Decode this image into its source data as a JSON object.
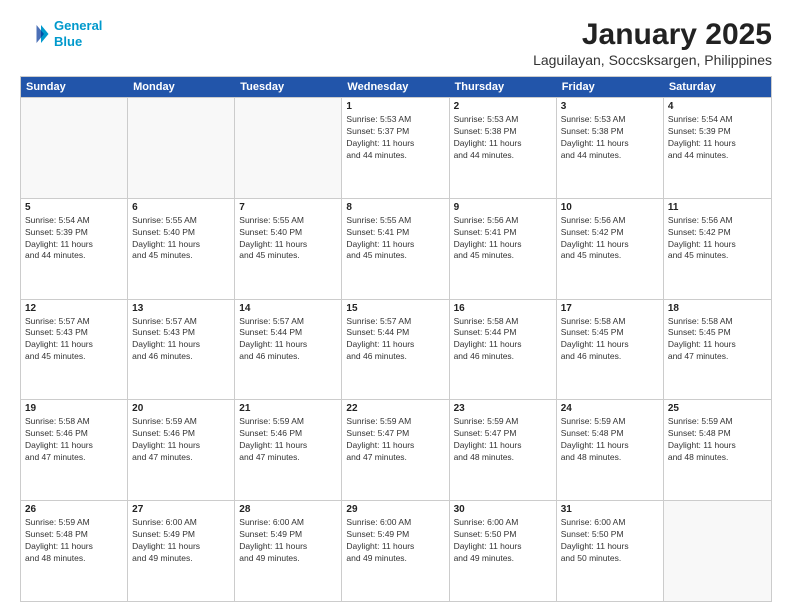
{
  "logo": {
    "line1": "General",
    "line2": "Blue"
  },
  "title": "January 2025",
  "subtitle": "Laguilayan, Soccsksargen, Philippines",
  "header_days": [
    "Sunday",
    "Monday",
    "Tuesday",
    "Wednesday",
    "Thursday",
    "Friday",
    "Saturday"
  ],
  "weeks": [
    [
      {
        "day": "",
        "detail": ""
      },
      {
        "day": "",
        "detail": ""
      },
      {
        "day": "",
        "detail": ""
      },
      {
        "day": "1",
        "detail": "Sunrise: 5:53 AM\nSunset: 5:37 PM\nDaylight: 11 hours\nand 44 minutes."
      },
      {
        "day": "2",
        "detail": "Sunrise: 5:53 AM\nSunset: 5:38 PM\nDaylight: 11 hours\nand 44 minutes."
      },
      {
        "day": "3",
        "detail": "Sunrise: 5:53 AM\nSunset: 5:38 PM\nDaylight: 11 hours\nand 44 minutes."
      },
      {
        "day": "4",
        "detail": "Sunrise: 5:54 AM\nSunset: 5:39 PM\nDaylight: 11 hours\nand 44 minutes."
      }
    ],
    [
      {
        "day": "5",
        "detail": "Sunrise: 5:54 AM\nSunset: 5:39 PM\nDaylight: 11 hours\nand 44 minutes."
      },
      {
        "day": "6",
        "detail": "Sunrise: 5:55 AM\nSunset: 5:40 PM\nDaylight: 11 hours\nand 45 minutes."
      },
      {
        "day": "7",
        "detail": "Sunrise: 5:55 AM\nSunset: 5:40 PM\nDaylight: 11 hours\nand 45 minutes."
      },
      {
        "day": "8",
        "detail": "Sunrise: 5:55 AM\nSunset: 5:41 PM\nDaylight: 11 hours\nand 45 minutes."
      },
      {
        "day": "9",
        "detail": "Sunrise: 5:56 AM\nSunset: 5:41 PM\nDaylight: 11 hours\nand 45 minutes."
      },
      {
        "day": "10",
        "detail": "Sunrise: 5:56 AM\nSunset: 5:42 PM\nDaylight: 11 hours\nand 45 minutes."
      },
      {
        "day": "11",
        "detail": "Sunrise: 5:56 AM\nSunset: 5:42 PM\nDaylight: 11 hours\nand 45 minutes."
      }
    ],
    [
      {
        "day": "12",
        "detail": "Sunrise: 5:57 AM\nSunset: 5:43 PM\nDaylight: 11 hours\nand 45 minutes."
      },
      {
        "day": "13",
        "detail": "Sunrise: 5:57 AM\nSunset: 5:43 PM\nDaylight: 11 hours\nand 46 minutes."
      },
      {
        "day": "14",
        "detail": "Sunrise: 5:57 AM\nSunset: 5:44 PM\nDaylight: 11 hours\nand 46 minutes."
      },
      {
        "day": "15",
        "detail": "Sunrise: 5:57 AM\nSunset: 5:44 PM\nDaylight: 11 hours\nand 46 minutes."
      },
      {
        "day": "16",
        "detail": "Sunrise: 5:58 AM\nSunset: 5:44 PM\nDaylight: 11 hours\nand 46 minutes."
      },
      {
        "day": "17",
        "detail": "Sunrise: 5:58 AM\nSunset: 5:45 PM\nDaylight: 11 hours\nand 46 minutes."
      },
      {
        "day": "18",
        "detail": "Sunrise: 5:58 AM\nSunset: 5:45 PM\nDaylight: 11 hours\nand 47 minutes."
      }
    ],
    [
      {
        "day": "19",
        "detail": "Sunrise: 5:58 AM\nSunset: 5:46 PM\nDaylight: 11 hours\nand 47 minutes."
      },
      {
        "day": "20",
        "detail": "Sunrise: 5:59 AM\nSunset: 5:46 PM\nDaylight: 11 hours\nand 47 minutes."
      },
      {
        "day": "21",
        "detail": "Sunrise: 5:59 AM\nSunset: 5:46 PM\nDaylight: 11 hours\nand 47 minutes."
      },
      {
        "day": "22",
        "detail": "Sunrise: 5:59 AM\nSunset: 5:47 PM\nDaylight: 11 hours\nand 47 minutes."
      },
      {
        "day": "23",
        "detail": "Sunrise: 5:59 AM\nSunset: 5:47 PM\nDaylight: 11 hours\nand 48 minutes."
      },
      {
        "day": "24",
        "detail": "Sunrise: 5:59 AM\nSunset: 5:48 PM\nDaylight: 11 hours\nand 48 minutes."
      },
      {
        "day": "25",
        "detail": "Sunrise: 5:59 AM\nSunset: 5:48 PM\nDaylight: 11 hours\nand 48 minutes."
      }
    ],
    [
      {
        "day": "26",
        "detail": "Sunrise: 5:59 AM\nSunset: 5:48 PM\nDaylight: 11 hours\nand 48 minutes."
      },
      {
        "day": "27",
        "detail": "Sunrise: 6:00 AM\nSunset: 5:49 PM\nDaylight: 11 hours\nand 49 minutes."
      },
      {
        "day": "28",
        "detail": "Sunrise: 6:00 AM\nSunset: 5:49 PM\nDaylight: 11 hours\nand 49 minutes."
      },
      {
        "day": "29",
        "detail": "Sunrise: 6:00 AM\nSunset: 5:49 PM\nDaylight: 11 hours\nand 49 minutes."
      },
      {
        "day": "30",
        "detail": "Sunrise: 6:00 AM\nSunset: 5:50 PM\nDaylight: 11 hours\nand 49 minutes."
      },
      {
        "day": "31",
        "detail": "Sunrise: 6:00 AM\nSunset: 5:50 PM\nDaylight: 11 hours\nand 50 minutes."
      },
      {
        "day": "",
        "detail": ""
      }
    ]
  ]
}
